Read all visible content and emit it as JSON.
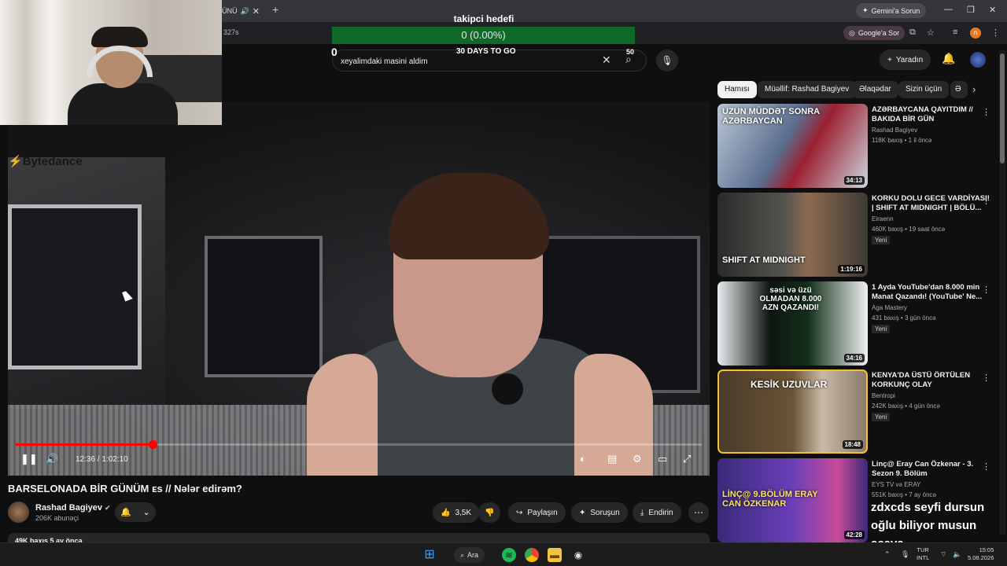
{
  "browser": {
    "tab_label": "ÜNÜ",
    "address_fragment": "327s",
    "gemini_button": "Gemini'a Sorun",
    "google_button": "Google'a Sor",
    "profile_initial": "n"
  },
  "goal_overlay": {
    "title": "takipci hedefi",
    "progress_text": "0 (0.00%)",
    "progress_fraction": 0,
    "min": "0",
    "days_left": "30 DAYS TO GO",
    "max": "50"
  },
  "header": {
    "search_value": "xeyalimdaki masini aldim",
    "create_label": "Yaradın"
  },
  "player": {
    "watermark": "Bytedance",
    "time_current": "12:36",
    "time_total": "1:02:10",
    "timecode_text": "12:36 / 1:02:10",
    "progress_fraction": 0.2
  },
  "video": {
    "title": "BARSELONADA BİR GÜNÜM ᴇs // Nələr edirəm?",
    "channel_name": "Rashad Bagiyev",
    "subscribers": "206K abunəçi",
    "likes": "3,5K",
    "share_label": "Paylaşın",
    "ask_label": "Soruşun",
    "download_label": "Endirin",
    "views_date": "49K baxış  5 ay öncə"
  },
  "chips": [
    {
      "label": "Hamısı",
      "active": true
    },
    {
      "label": "Müəllif: Rashad Bagiyev",
      "active": false
    },
    {
      "label": "Əlaqədar",
      "active": false
    },
    {
      "label": "Sizin üçün",
      "active": false
    },
    {
      "label": "Ə",
      "active": false
    }
  ],
  "recommendations": [
    {
      "title": "AZƏRBAYCANA QAYITDIM // BAKIDA BİR GÜN",
      "channel": "Rashad Bagiyev",
      "meta": "118K baxış • 1 il öncə",
      "badge": "",
      "duration": "34:13",
      "thumb_caption": "UZUN MÜDDƏT SONRA AZƏRBAYCAN"
    },
    {
      "title": "KORKU DOLU GECE VARDİYASI! | SHIFT AT MIDNIGHT | BÖLÜ...",
      "channel": "Eiraenn",
      "meta": "460K baxış • 19 saat öncə",
      "badge": "Yeni",
      "duration": "1:19:16",
      "thumb_caption": "SHIFT AT MIDNIGHT"
    },
    {
      "title": "1 Ayda YouTube'dan 8.000 min Manat Qazandı! (YouTube' Ne...",
      "channel": "Aga Mastery",
      "meta": "431 baxış • 3 gün öncə",
      "badge": "Yeni",
      "duration": "34:16",
      "thumb_caption": "səsi və üzü OLMADAN 8.000 AZN QAZANDI!"
    },
    {
      "title": "KENYA'DA ÜSTÜ ÖRTÜLEN KORKUNÇ OLAY",
      "channel": "Bentropi",
      "meta": "242K baxış • 4 gün öncə",
      "badge": "Yeni",
      "duration": "18:48",
      "thumb_caption": "KESİK UZUVLAR"
    },
    {
      "title": "Linç@ Eray Can Özkenar - 3. Sezon 9. Bölüm",
      "channel": "EYS TV və ERAY",
      "meta": "551K baxış • 7 ay öncə",
      "badge": "",
      "duration": "42:28",
      "thumb_caption": "LİNÇ@ 9.BÖLÜM ERAY CAN ÖZKENAR"
    }
  ],
  "overlay_tts": {
    "username": "zdxcds",
    "message": "seyfi dursun oğlu biliyor musun acava"
  },
  "taskbar": {
    "search_label": "Ara",
    "lang_line1": "TUR",
    "lang_line2": "INTL",
    "time": "15:05",
    "date": "5.08.2026"
  },
  "colors": {
    "goal_bar": "#0f6a2a",
    "progress_red": "#ff0000",
    "background": "#0f0f0f"
  }
}
